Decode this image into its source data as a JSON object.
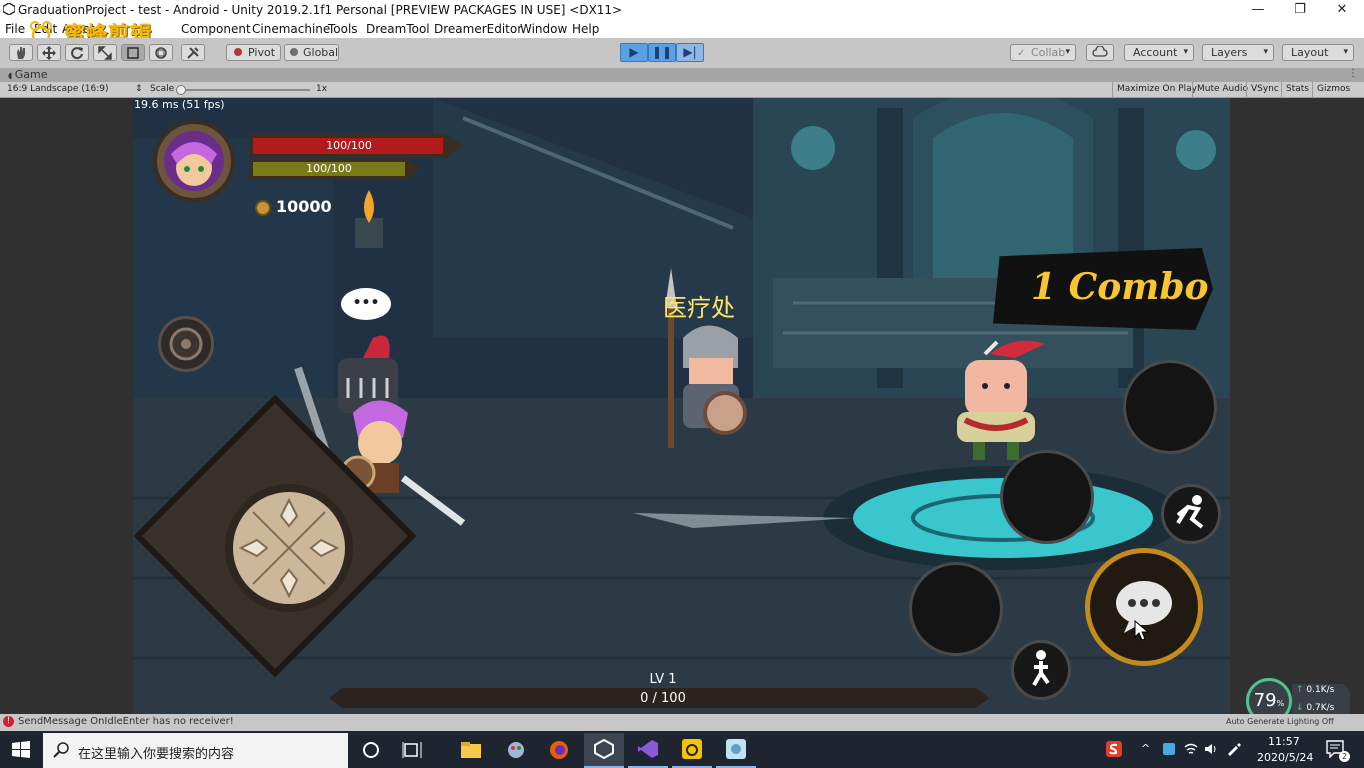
{
  "window": {
    "title": "GraduationProject - test - Android - Unity 2019.2.1f1 Personal [PREVIEW PACKAGES IN USE] <DX11>",
    "controls": [
      "—",
      "❐",
      "✕"
    ]
  },
  "watermark": "蜜蜂剪辑",
  "menu": [
    "File",
    "Edit",
    "Assets",
    "Component",
    "Cinemachine",
    "Tools",
    "DreamTool",
    "DreamerEditor",
    "Window",
    "Help"
  ],
  "toolbar": {
    "pivot": "Pivot",
    "global": "Global",
    "collab": "Collab",
    "account": "Account",
    "layers": "Layers",
    "layout": "Layout"
  },
  "game_tab": {
    "label": "Game",
    "aspect": "16:9 Landscape (16:9)",
    "scale_label": "Scale",
    "scale_value": "1x",
    "scale_level": 0,
    "options": [
      "Maximize On Play",
      "Mute Audio",
      "VSync",
      "Stats",
      "Gizmos"
    ]
  },
  "game": {
    "fps": "19.6 ms (51 fps)",
    "hp": "100/100",
    "mp": "100/100",
    "hp_fraction": 1.0,
    "mp_fraction": 1.0,
    "coins": "10000",
    "npc_label": "医疗处",
    "combo": "1 Combo",
    "speech": "•••",
    "level": "LV 1",
    "exp": "0 / 100",
    "exp_fraction": 0
  },
  "status": {
    "message": "SendMessage OnIdleEnter has no receiver!",
    "right": "Auto Generate Lighting Off"
  },
  "overlay": {
    "percent": "79",
    "up": "0.1K/s",
    "down": "0.7K/s"
  },
  "taskbar": {
    "search_placeholder": "在这里输入你要搜索的内容",
    "time": "11:57",
    "date": "2020/5/24",
    "notifications": "2"
  }
}
